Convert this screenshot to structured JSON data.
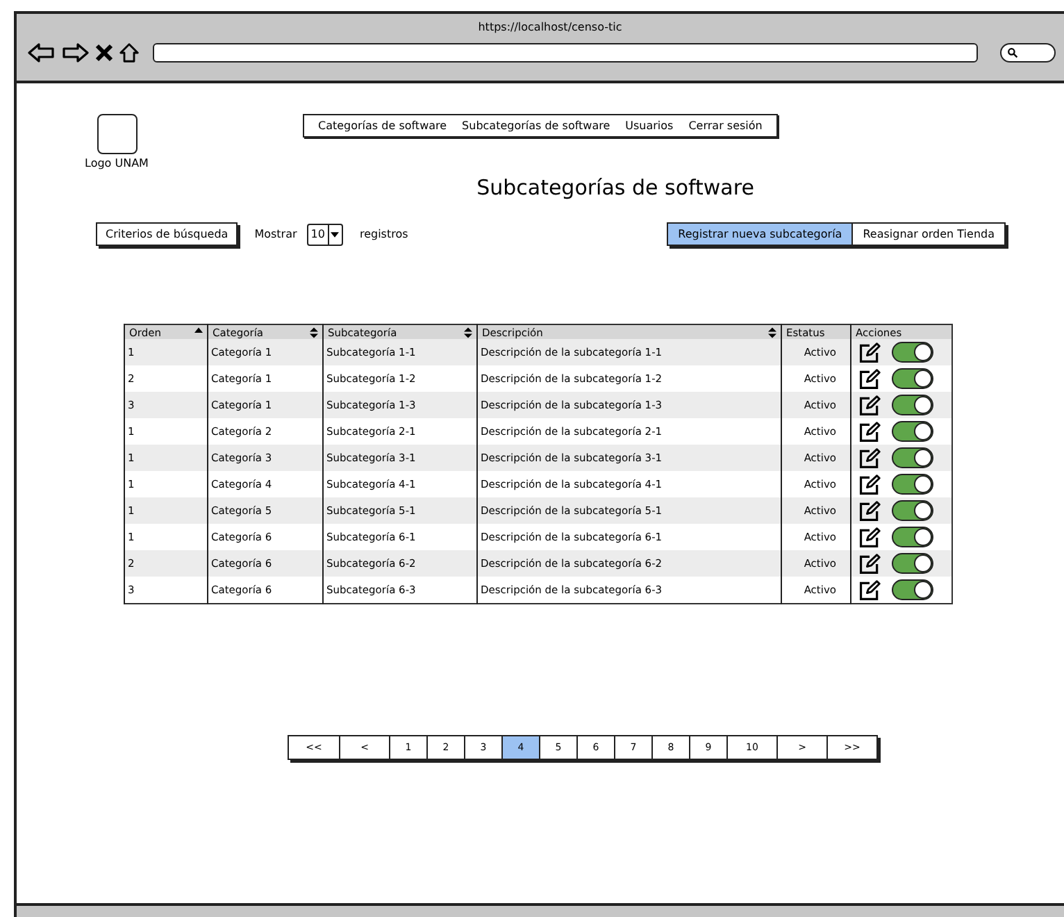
{
  "browser": {
    "url": "https://localhost/censo-tic"
  },
  "logo": {
    "label": "Logo UNAM"
  },
  "nav": [
    {
      "label": "Categorías de software"
    },
    {
      "label": "Subcategorías de software"
    },
    {
      "label": "Usuarios"
    },
    {
      "label": "Cerrar sesión"
    }
  ],
  "title": "Subcategorías de software",
  "toolbar": {
    "search_button": "Criterios de búsqueda",
    "show_label": "Mostrar",
    "page_size": "10",
    "records_label": "registros",
    "actions": [
      {
        "label": "Registrar nueva subcategoría",
        "selected": true
      },
      {
        "label": "Reasignar orden Tienda",
        "selected": false
      }
    ]
  },
  "table": {
    "columns": [
      {
        "label": "Orden",
        "sortable": true,
        "sorted": true
      },
      {
        "label": "Categoría",
        "sortable": true,
        "sorted": false
      },
      {
        "label": "Subcategoría",
        "sortable": true,
        "sorted": false
      },
      {
        "label": "Descripción",
        "sortable": true,
        "sorted": false
      },
      {
        "label": "Estatus",
        "sortable": false,
        "sorted": false
      },
      {
        "label": "Acciones",
        "sortable": false,
        "sorted": false
      }
    ],
    "rows": [
      {
        "orden": "1",
        "categoria": "Categoría 1",
        "subcategoria": "Subcategoría 1-1",
        "descripcion": "Descripción de la subcategoría 1-1",
        "estatus": "Activo",
        "on": true
      },
      {
        "orden": "2",
        "categoria": "Categoría 1",
        "subcategoria": "Subcategoría 1-2",
        "descripcion": "Descripción de la subcategoría 1-2",
        "estatus": "Activo",
        "on": true
      },
      {
        "orden": "3",
        "categoria": "Categoría 1",
        "subcategoria": "Subcategoría 1-3",
        "descripcion": "Descripción de la subcategoría 1-3",
        "estatus": "Activo",
        "on": true
      },
      {
        "orden": "1",
        "categoria": "Categoría 2",
        "subcategoria": "Subcategoría 2-1",
        "descripcion": "Descripción de la subcategoría 2-1",
        "estatus": "Activo",
        "on": true
      },
      {
        "orden": "1",
        "categoria": "Categoría 3",
        "subcategoria": "Subcategoría 3-1",
        "descripcion": "Descripción de la subcategoría 3-1",
        "estatus": "Activo",
        "on": true
      },
      {
        "orden": "1",
        "categoria": "Categoría 4",
        "subcategoria": "Subcategoría 4-1",
        "descripcion": "Descripción de la subcategoría 4-1",
        "estatus": "Activo",
        "on": true
      },
      {
        "orden": "1",
        "categoria": "Categoría 5",
        "subcategoria": "Subcategoría 5-1",
        "descripcion": "Descripción de la subcategoría 5-1",
        "estatus": "Activo",
        "on": true
      },
      {
        "orden": "1",
        "categoria": "Categoría 6",
        "subcategoria": "Subcategoría 6-1",
        "descripcion": "Descripción de la subcategoría 6-1",
        "estatus": "Activo",
        "on": true
      },
      {
        "orden": "2",
        "categoria": "Categoría 6",
        "subcategoria": "Subcategoría 6-2",
        "descripcion": "Descripción de la subcategoría 6-2",
        "estatus": "Activo",
        "on": true
      },
      {
        "orden": "3",
        "categoria": "Categoría 6",
        "subcategoria": "Subcategoría 6-3",
        "descripcion": "Descripción de la subcategoría 6-3",
        "estatus": "Activo",
        "on": true
      }
    ]
  },
  "pagination": [
    {
      "label": "<<",
      "selected": false
    },
    {
      "label": "<",
      "selected": false
    },
    {
      "label": "1",
      "selected": false
    },
    {
      "label": "2",
      "selected": false
    },
    {
      "label": "3",
      "selected": false
    },
    {
      "label": "4",
      "selected": true
    },
    {
      "label": "5",
      "selected": false
    },
    {
      "label": "6",
      "selected": false
    },
    {
      "label": "7",
      "selected": false
    },
    {
      "label": "8",
      "selected": false
    },
    {
      "label": "9",
      "selected": false
    },
    {
      "label": "10",
      "selected": false
    },
    {
      "label": ">",
      "selected": false
    },
    {
      "label": ">>",
      "selected": false
    }
  ]
}
